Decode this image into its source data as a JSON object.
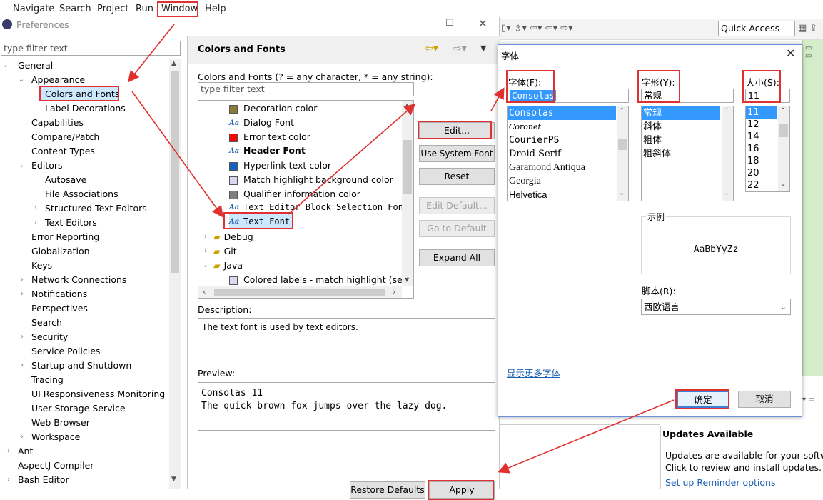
{
  "menubar": {
    "items": [
      "Navigate",
      "Search",
      "Project",
      "Run",
      "Window",
      "Help"
    ]
  },
  "prefs": {
    "title": "Preferences",
    "filter_placeholder": "type filter text",
    "tree": [
      {
        "label": "General",
        "expanded": true
      },
      {
        "label": "Appearance",
        "expanded": true
      },
      {
        "label": "Colors and Fonts",
        "selected": true
      },
      {
        "label": "Label Decorations"
      },
      {
        "label": "Capabilities"
      },
      {
        "label": "Compare/Patch"
      },
      {
        "label": "Content Types"
      },
      {
        "label": "Editors",
        "expanded": true
      },
      {
        "label": "Autosave"
      },
      {
        "label": "File Associations"
      },
      {
        "label": "Structured Text Editors"
      },
      {
        "label": "Text Editors"
      },
      {
        "label": "Error Reporting"
      },
      {
        "label": "Globalization"
      },
      {
        "label": "Keys"
      },
      {
        "label": "Network Connections"
      },
      {
        "label": "Notifications"
      },
      {
        "label": "Perspectives"
      },
      {
        "label": "Search"
      },
      {
        "label": "Security"
      },
      {
        "label": "Service Policies"
      },
      {
        "label": "Startup and Shutdown"
      },
      {
        "label": "Tracing"
      },
      {
        "label": "UI Responsiveness Monitoring"
      },
      {
        "label": "User Storage Service"
      },
      {
        "label": "Web Browser"
      },
      {
        "label": "Workspace"
      },
      {
        "label": "Ant"
      },
      {
        "label": "AspectJ Compiler"
      },
      {
        "label": "Bash Editor"
      }
    ],
    "page_title": "Colors and Fonts",
    "page_desc": "Colors and Fonts (? = any character, * = any string):",
    "cf_filter_placeholder": "type filter text",
    "cf_items": [
      {
        "label": "Decoration color",
        "kind": "color",
        "color": "#8a7a3a"
      },
      {
        "label": "Dialog Font",
        "kind": "font"
      },
      {
        "label": "Error text color",
        "kind": "color",
        "color": "#ff0000"
      },
      {
        "label": "Header Font",
        "kind": "font",
        "bold": true
      },
      {
        "label": "Hyperlink text color",
        "kind": "color",
        "color": "#1560bd"
      },
      {
        "label": "Match highlight background color",
        "kind": "color",
        "color": "#d8d8f0"
      },
      {
        "label": "Qualifier information color",
        "kind": "color",
        "color": "#7f7f7f"
      },
      {
        "label": "Text Editor Block Selection Font",
        "kind": "font",
        "mono": true
      },
      {
        "label": "Text Font",
        "kind": "font",
        "mono": true,
        "selected": true
      }
    ],
    "cf_groups": [
      "Debug",
      "Git",
      "Java"
    ],
    "cf_java_child": "Colored labels - match highlight (set t",
    "buttons": {
      "edit": "Edit...",
      "use_system": "Use System Font",
      "reset": "Reset",
      "edit_default": "Edit Default...",
      "go_default": "Go to Default",
      "expand_all": "Expand All",
      "restore": "Restore Defaults",
      "apply": "Apply"
    },
    "description_label": "Description:",
    "description_text": "The text font is used by text editors.",
    "preview_label": "Preview:",
    "preview_line1": "Consolas 11",
    "preview_line2": "The quick brown fox jumps over the lazy dog."
  },
  "font_dialog": {
    "title": "字体",
    "font_label": "字体(F):",
    "style_label": "字形(Y):",
    "size_label": "大小(S):",
    "font_value": "Consolas",
    "style_value": "常规",
    "size_value": "11",
    "fonts": [
      "Consolas",
      "Coronet",
      "CourierPS",
      "Droid Serif",
      "Garamond Antiqua",
      "Georgia",
      "Helvetica"
    ],
    "styles": [
      "常规",
      "斜体",
      "粗体",
      "粗斜体"
    ],
    "sizes": [
      "11",
      "12",
      "14",
      "16",
      "18",
      "20",
      "22"
    ],
    "sample_label": "示例",
    "sample_text": "AaBbYyZz",
    "script_label": "脚本(R):",
    "script_value": "西欧语言",
    "more_fonts": "显示更多字体",
    "ok": "确定",
    "cancel": "取消"
  },
  "ide": {
    "quick_access": "Quick Access",
    "updates_title": "Updates Available",
    "updates_line1": "Updates are available for your softwa",
    "updates_line2": "Click to review and install updates.",
    "updates_line3": "Set up Reminder options"
  }
}
